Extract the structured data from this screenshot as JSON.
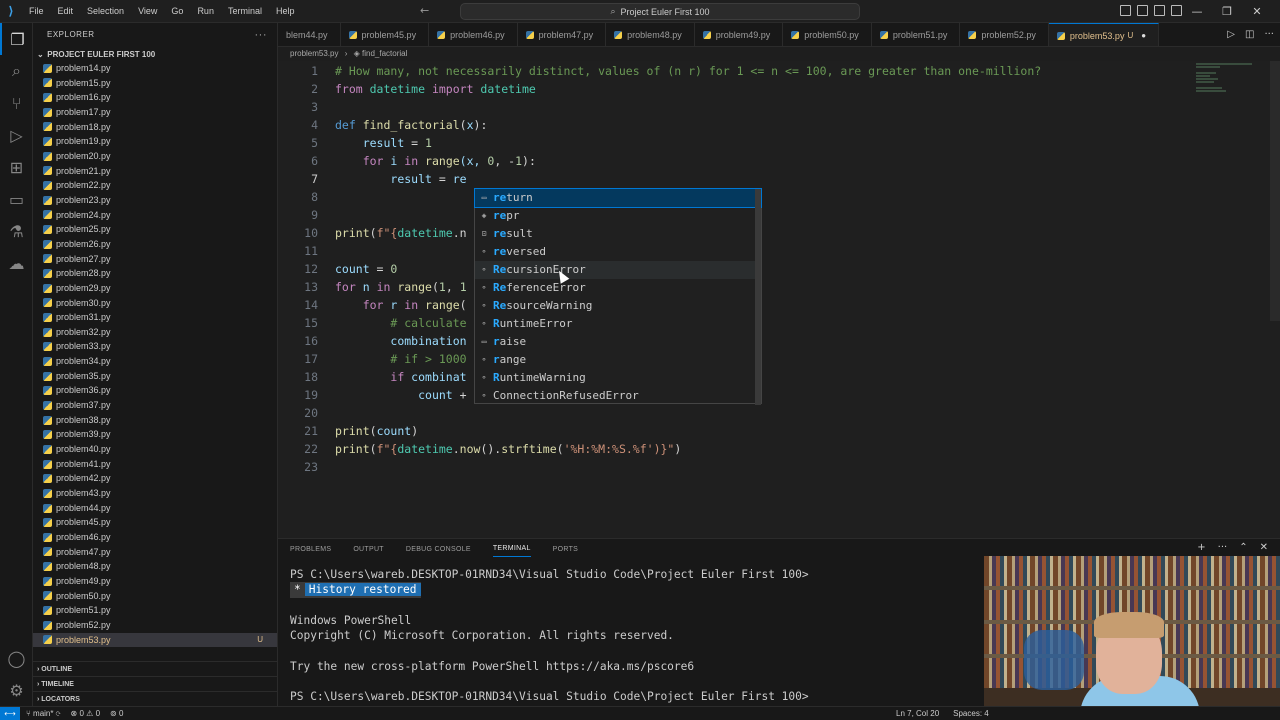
{
  "titlebar": {
    "menu": [
      "File",
      "Edit",
      "Selection",
      "View",
      "Go",
      "Run",
      "Terminal",
      "Help"
    ],
    "search": "Project Euler First 100"
  },
  "sidebar": {
    "header": "EXPLORER",
    "folder": "PROJECT EULER FIRST 100",
    "files": [
      "problem14.py",
      "problem15.py",
      "problem16.py",
      "problem17.py",
      "problem18.py",
      "problem19.py",
      "problem20.py",
      "problem21.py",
      "problem22.py",
      "problem23.py",
      "problem24.py",
      "problem25.py",
      "problem26.py",
      "problem27.py",
      "problem28.py",
      "problem29.py",
      "problem30.py",
      "problem31.py",
      "problem32.py",
      "problem33.py",
      "problem34.py",
      "problem35.py",
      "problem36.py",
      "problem37.py",
      "problem38.py",
      "problem39.py",
      "problem40.py",
      "problem41.py",
      "problem42.py",
      "problem43.py",
      "problem44.py",
      "problem45.py",
      "problem46.py",
      "problem47.py",
      "problem48.py",
      "problem49.py",
      "problem50.py",
      "problem51.py",
      "problem52.py",
      "problem53.py"
    ],
    "selected_badge": "U",
    "sections": [
      "OUTLINE",
      "TIMELINE",
      "LOCATORS"
    ]
  },
  "tabs": [
    "blem44.py",
    "problem45.py",
    "problem46.py",
    "problem47.py",
    "problem48.py",
    "problem49.py",
    "problem50.py",
    "problem51.py",
    "problem52.py"
  ],
  "active_tab": {
    "label": "problem53.py",
    "badge": "U"
  },
  "breadcrumb": {
    "file": "problem53.py",
    "symbol": "find_factorial"
  },
  "editor": {
    "line_numbers": [
      "1",
      "2",
      "3",
      "4",
      "5",
      "6",
      "7",
      "8",
      "9",
      "10",
      "11",
      "12",
      "13",
      "14",
      "15",
      "16",
      "17",
      "18",
      "19",
      "20",
      "21",
      "22",
      "23"
    ],
    "lines": {
      "l1": "# How many, not necessarily distinct, values of (n r) for 1 <= n <= 100, are greater than one-million?",
      "l2a": "from",
      "l2b": " datetime ",
      "l2c": "import",
      "l2d": " datetime",
      "l4a": "def",
      "l4b": " find_factorial",
      "l4c": "(",
      "l4d": "x",
      "l4e": "):",
      "l5a": "result",
      "l5b": " = ",
      "l5c": "1",
      "l6a": "for",
      "l6b": " i ",
      "l6c": "in",
      "l6d": " range",
      "l6e": "(x, ",
      "l6f": "0",
      "l6g": ", -",
      "l6h": "1",
      "l6i": "):",
      "l7a": "result",
      "l7b": " = ",
      "l7c": "re",
      "l10a": "print",
      "l10b": "(",
      "l10c": "f\"{",
      "l10d": "datetime",
      "l10e": ".n",
      "l12a": "count",
      "l12b": " = ",
      "l12c": "0",
      "l13a": "for",
      "l13b": " n ",
      "l13c": "in",
      "l13d": " range",
      "l13e": "(",
      "l13f": "1",
      "l13g": ", ",
      "l13h": "1",
      "l14a": "for",
      "l14b": " r ",
      "l14c": "in",
      "l14d": " range",
      "l14e": "(",
      "l15": "# calculate",
      "l16": "combination",
      "l17a": "# if > ",
      "l17b": "1000",
      "l18a": "if",
      "l18b": " combinat",
      "l19a": "count",
      "l19b": " +",
      "l21a": "print",
      "l21b": "(",
      "l21c": "count",
      "l21d": ")",
      "l22a": "print",
      "l22b": "(",
      "l22c": "f\"{",
      "l22d": "datetime",
      "l22e": ".",
      "l22f": "now",
      "l22g": "().",
      "l22h": "strftime",
      "l22i": "(",
      "l22j": "'%H:%M:%S.%f'",
      "l22k": ")}\"",
      "l22l": ")"
    }
  },
  "suggestions": [
    {
      "icon": "keyword",
      "match": "re",
      "rest": "turn"
    },
    {
      "icon": "function",
      "match": "re",
      "rest": "pr"
    },
    {
      "icon": "variable",
      "match": "re",
      "rest": "sult"
    },
    {
      "icon": "class",
      "match": "re",
      "rest": "versed"
    },
    {
      "icon": "class",
      "match": "Re",
      "rest": "cursionError"
    },
    {
      "icon": "class",
      "match": "Re",
      "rest": "ferenceError"
    },
    {
      "icon": "class",
      "match": "Re",
      "rest": "sourceWarning"
    },
    {
      "icon": "class",
      "match": "R",
      "rest": "untimeError"
    },
    {
      "icon": "keyword",
      "match": "r",
      "rest": "aise"
    },
    {
      "icon": "class",
      "match": "r",
      "rest": "ange"
    },
    {
      "icon": "class",
      "match": "R",
      "rest": "untimeWarning"
    },
    {
      "icon": "class",
      "match": "",
      "rest": "ConnectionRefusedError"
    }
  ],
  "panel": {
    "tabs": [
      "PROBLEMS",
      "OUTPUT",
      "DEBUG CONSOLE",
      "TERMINAL",
      "PORTS"
    ],
    "terminal": {
      "l1": "PS C:\\Users\\wareb.DESKTOP-01RND34\\Visual Studio Code\\Project Euler First 100>",
      "hist_star": "*",
      "hist_text": "History restored",
      "l3": "Windows PowerShell",
      "l4": "Copyright (C) Microsoft Corporation. All rights reserved.",
      "l6": "Try the new cross-platform PowerShell https://aka.ms/pscore6",
      "l8": "PS C:\\Users\\wareb.DESKTOP-01RND34\\Visual Studio Code\\Project Euler First 100>"
    }
  },
  "statusbar": {
    "branch": "main*",
    "errors": "0",
    "warnings": "0",
    "ports": "0",
    "position": "Ln 7, Col 20",
    "spaces": "Spaces: 4"
  }
}
